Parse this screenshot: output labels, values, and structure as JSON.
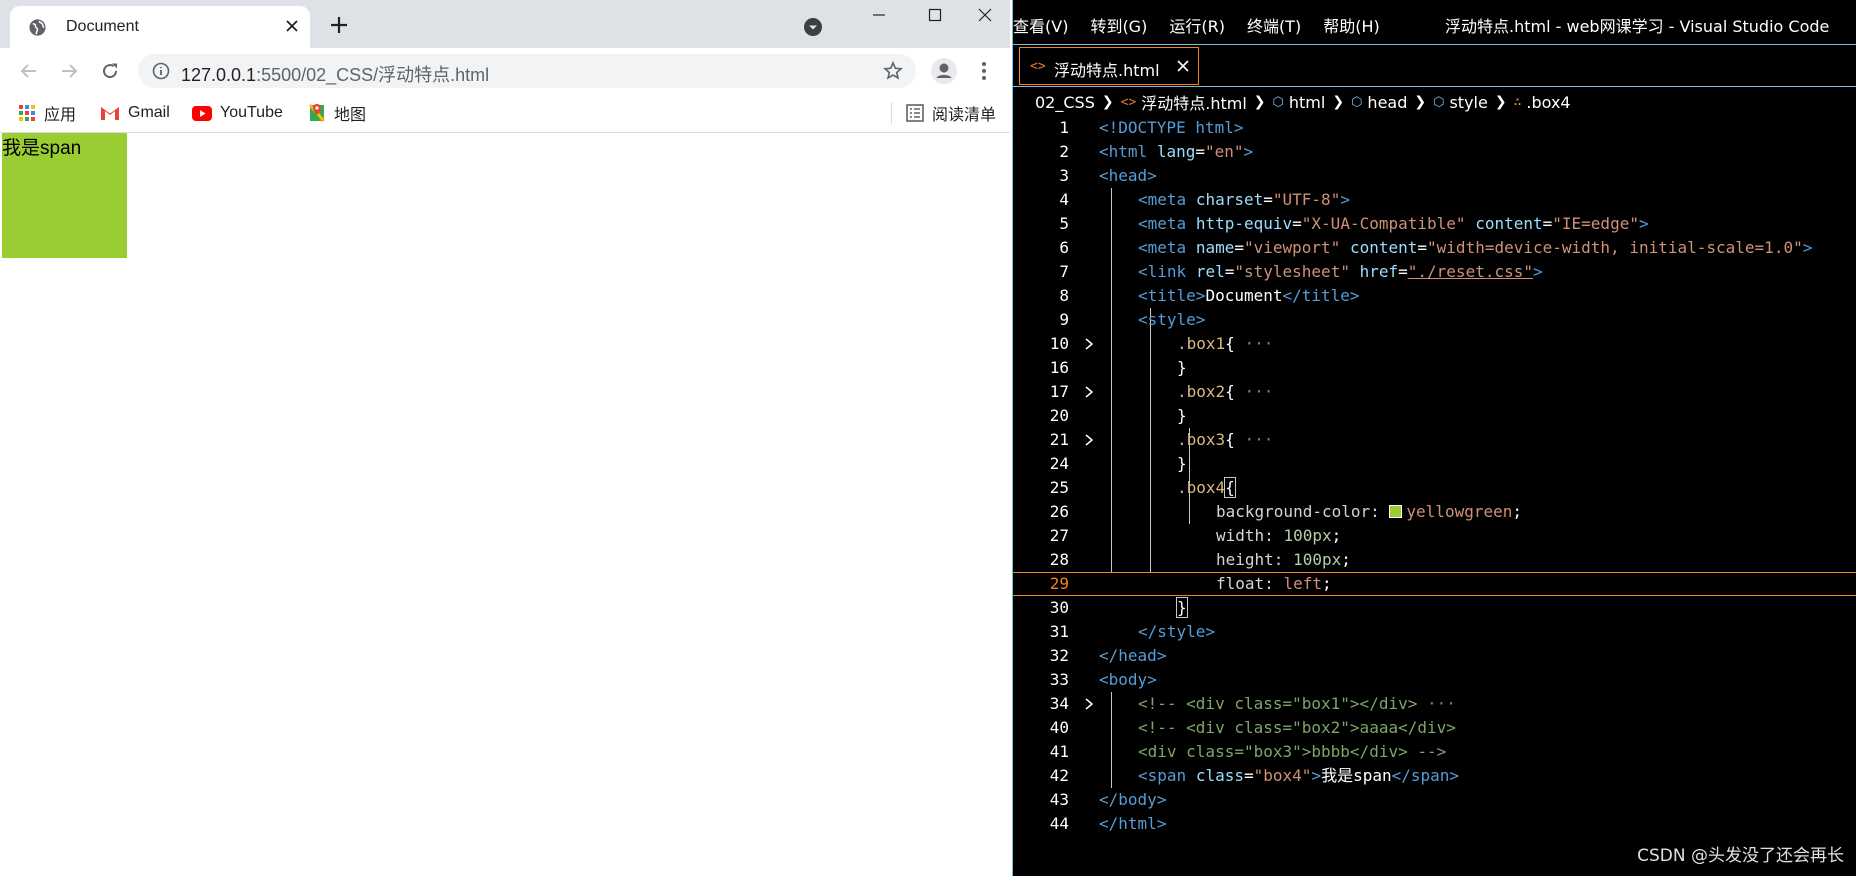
{
  "browser": {
    "tab_title": "Document",
    "url_host": "127.0.0.1",
    "url_rest": ":5500/02_CSS/浮动特点.html",
    "bookmarks": [
      {
        "label": "应用",
        "icon": "apps-grid-icon"
      },
      {
        "label": "Gmail",
        "icon": "gmail-icon"
      },
      {
        "label": "YouTube",
        "icon": "youtube-icon"
      },
      {
        "label": "地图",
        "icon": "maps-icon"
      }
    ],
    "reading_list": "阅读清单",
    "page": {
      "span_text": "我是span",
      "box_color": "#9acd32"
    }
  },
  "vscode": {
    "menu": [
      "查看(V)",
      "转到(G)",
      "运行(R)",
      "终端(T)",
      "帮助(H)"
    ],
    "window_title": "浮动特点.html - web网课学习 - Visual Studio Code",
    "tab_label": "浮动特点.html",
    "breadcrumbs": [
      "02_CSS",
      "浮动特点.html",
      "html",
      "head",
      "style",
      ".box4"
    ],
    "current_line": "29",
    "line_numbers": [
      "1",
      "2",
      "3",
      "4",
      "5",
      "6",
      "7",
      "8",
      "9",
      "10",
      "16",
      "17",
      "20",
      "21",
      "24",
      "25",
      "26",
      "27",
      "28",
      "29",
      "30",
      "31",
      "32",
      "33",
      "34",
      "40",
      "41",
      "42",
      "43",
      "44"
    ],
    "code": {
      "l1": "<!DOCTYPE html>",
      "l2a": "<html",
      "l2b": "lang",
      "l2c": "\"en\"",
      "l3": "<head>",
      "l4a": "<meta",
      "l4b": "charset",
      "l4c": "\"UTF-8\"",
      "l5a": "<meta",
      "l5b": "http-equiv",
      "l5c": "\"X-UA-Compatible\"",
      "l5d": "content",
      "l5e": "\"IE=edge\"",
      "l6a": "<meta",
      "l6b": "name",
      "l6c": "\"viewport\"",
      "l6d": "content",
      "l6e": "\"width=device-width, initial-scale=1.0\"",
      "l7a": "<link",
      "l7b": "rel",
      "l7c": "\"stylesheet\"",
      "l7d": "href",
      "l7e": "\"./reset.css\"",
      "l8a": "<title>",
      "l8b": "Document",
      "l8c": "</title>",
      "l9": "<style>",
      "l10": ".box1",
      "l17": ".box2",
      "l21": ".box3",
      "l25": ".box4",
      "l26a": "background-color:",
      "l26b": "yellowgreen",
      "l27a": "width:",
      "l27b": "100px",
      "l28a": "height:",
      "l28b": "100px",
      "l29a": "float:",
      "l29b": "left",
      "l31": "</style>",
      "l32": "</head>",
      "l33": "<body>",
      "l34": "<!-- <div class=\"box1\"></div>",
      "l40": "<!-- <div class=\"box2\">aaaa</div>",
      "l41": "<div class=\"box3\">bbbb</div> -->",
      "l42a": "<span",
      "l42b": "class",
      "l42c": "\"box4\"",
      "l42d": "我是span",
      "l42e": "</span>",
      "l43": "</body>",
      "l44": "</html>"
    }
  },
  "watermark": "CSDN @头发没了还会再长"
}
